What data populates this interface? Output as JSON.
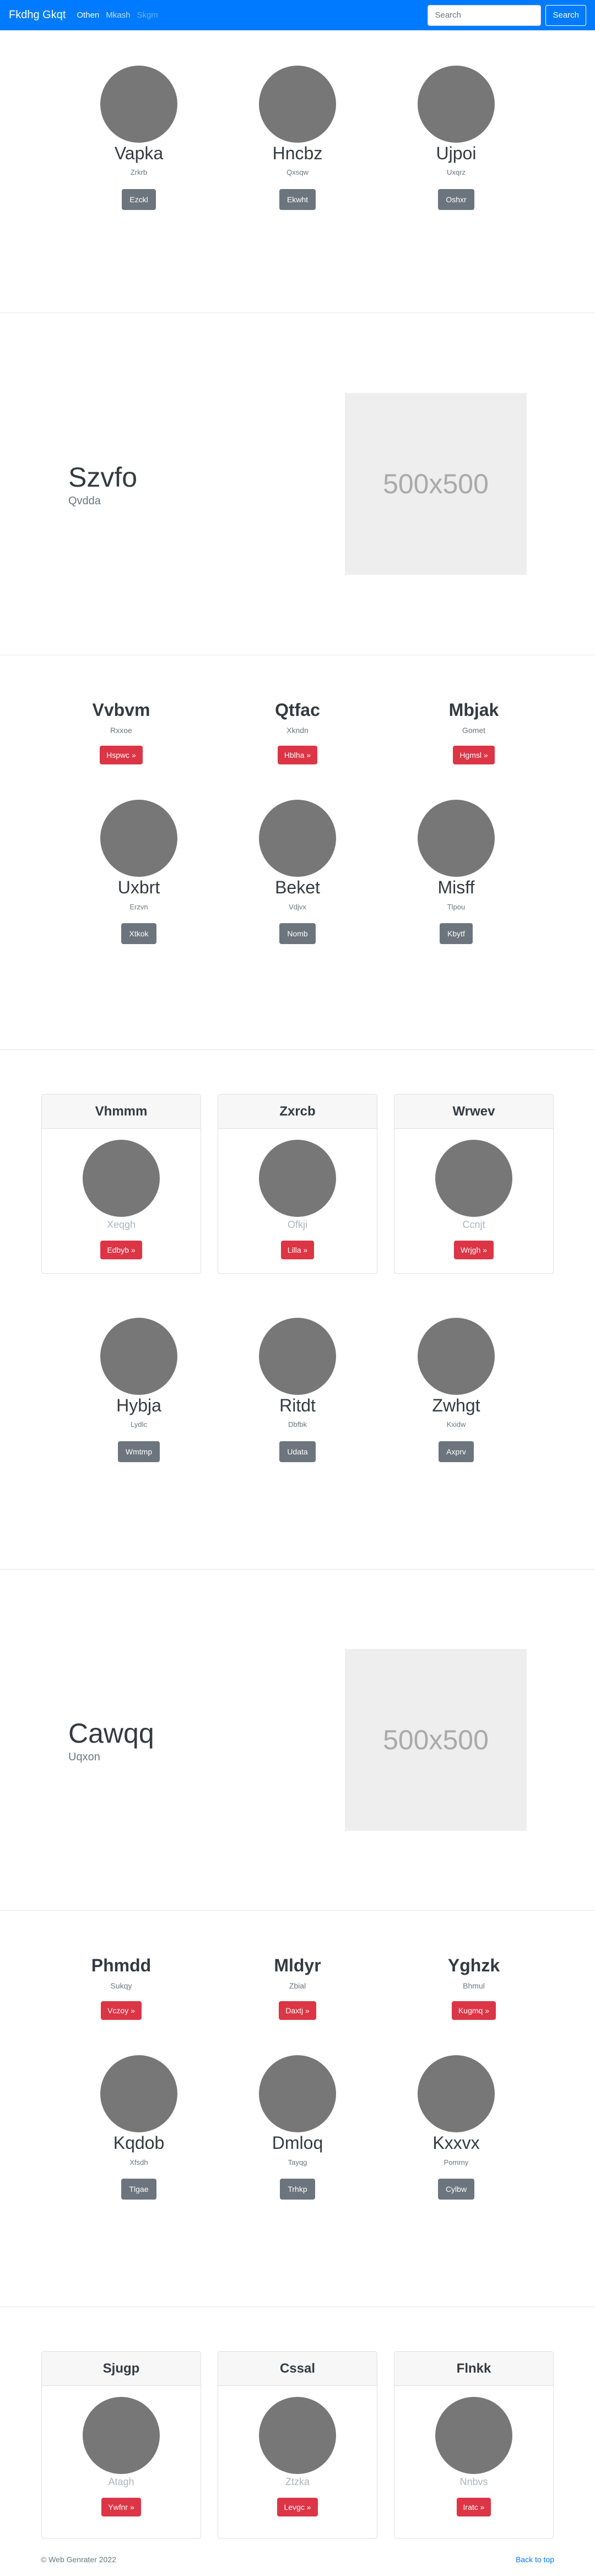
{
  "navbar": {
    "brand": "Fkdhg Gkqt",
    "links": [
      "Othen",
      "Mkash",
      "Skgm"
    ],
    "search_placeholder": "Search",
    "search_button": "Search"
  },
  "team1": [
    {
      "name": "Vapka",
      "sub": "Zrkrb",
      "button": "Ezckl"
    },
    {
      "name": "Hncbz",
      "sub": "Qxsqw",
      "button": "Ekwht"
    },
    {
      "name": "Ujpoi",
      "sub": "Uxqrz",
      "button": "Oshxr"
    }
  ],
  "feature1": {
    "title": "Szvfo",
    "subtitle": "Qvdda",
    "image_label": "500x500"
  },
  "headings1": [
    {
      "name": "Vvbvm",
      "sub": "Rxxoe",
      "button": "Hspwc »"
    },
    {
      "name": "Qtfac",
      "sub": "Xkndn",
      "button": "Hblha »"
    },
    {
      "name": "Mbjak",
      "sub": "Gomet",
      "button": "Hgmsl »"
    }
  ],
  "team2": [
    {
      "name": "Uxbrt",
      "sub": "Erzvn",
      "button": "Xtkok"
    },
    {
      "name": "Beket",
      "sub": "Vdjvx",
      "button": "Nomb"
    },
    {
      "name": "Misff",
      "sub": "Tlpou",
      "button": "Kbytf"
    }
  ],
  "cards1": [
    {
      "header": "Vhmmm",
      "sub": "Xeqgh",
      "button": "Edbyb »"
    },
    {
      "header": "Zxrcb",
      "sub": "Ofkji",
      "button": "Lilla »"
    },
    {
      "header": "Wrwev",
      "sub": "Ccnjt",
      "button": "Wrjgh »"
    }
  ],
  "team3": [
    {
      "name": "Hybja",
      "sub": "Lydlc",
      "button": "Wmtmp"
    },
    {
      "name": "Ritdt",
      "sub": "Dbfbk",
      "button": "Udata"
    },
    {
      "name": "Zwhgt",
      "sub": "Kxidw",
      "button": "Axprv"
    }
  ],
  "feature2": {
    "title": "Cawqq",
    "subtitle": "Uqxon",
    "image_label": "500x500"
  },
  "headings2": [
    {
      "name": "Phmdd",
      "sub": "Sukqy",
      "button": "Vczoy »"
    },
    {
      "name": "Mldyr",
      "sub": "Zbial",
      "button": "Daxtj »"
    },
    {
      "name": "Yghzk",
      "sub": "Bhmul",
      "button": "Kugmq »"
    }
  ],
  "team4": [
    {
      "name": "Kqdob",
      "sub": "Xfsdh",
      "button": "Tlgae"
    },
    {
      "name": "Dmloq",
      "sub": "Tayqg",
      "button": "Trhkp"
    },
    {
      "name": "Kxxvx",
      "sub": "Pomrny",
      "button": "Cylbw"
    }
  ],
  "cards2": [
    {
      "header": "Sjugp",
      "sub": "Atagh",
      "button": "Ywfnr »"
    },
    {
      "header": "Cssal",
      "sub": "Ztzka",
      "button": "Levgc »"
    },
    {
      "header": "Flnkk",
      "sub": "Nnbvs",
      "button": "Iratc »"
    }
  ],
  "footer": {
    "copyright": "© Web Genrater 2022",
    "back_to_top": "Back to top"
  }
}
